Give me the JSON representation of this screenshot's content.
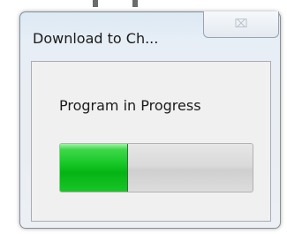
{
  "window": {
    "title": "Download to Ch...",
    "close_icon": "⌧"
  },
  "dialog": {
    "status_text": "Program in Progress",
    "progress_fraction": 0.35,
    "progress_color": "#12c522"
  }
}
